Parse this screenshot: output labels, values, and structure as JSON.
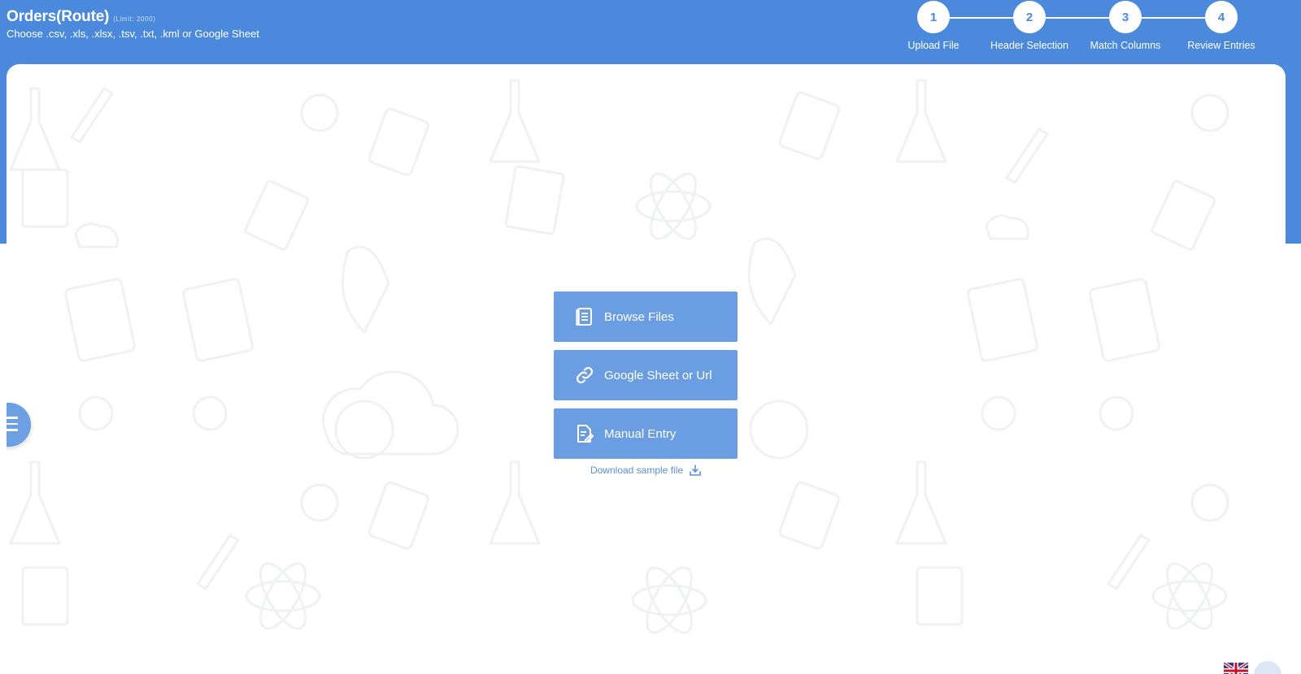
{
  "header": {
    "title": "Orders(Route)",
    "limit": "(Limit: 2000)",
    "subtitle": "Choose .csv, .xls, .xlsx, .tsv, .txt, .kml or Google Sheet"
  },
  "steps": [
    {
      "number": "1",
      "label": "Upload File"
    },
    {
      "number": "2",
      "label": "Header Selection"
    },
    {
      "number": "3",
      "label": "Match Columns"
    },
    {
      "number": "4",
      "label": "Review Entries"
    }
  ],
  "actions": {
    "browse_label": "Browse Files",
    "browse_icon": "document-icon",
    "sheet_label": "Google Sheet or Url",
    "sheet_icon": "link-icon",
    "manual_label": "Manual Entry",
    "manual_icon": "edit-document-icon"
  },
  "sample_link": {
    "label": "Download sample file",
    "icon": "download-icon"
  },
  "colors": {
    "header_bg": "#4a89dc",
    "button_bg": "#6b9de2",
    "link": "#5b8fd8",
    "card_bg": "#ffffff"
  }
}
